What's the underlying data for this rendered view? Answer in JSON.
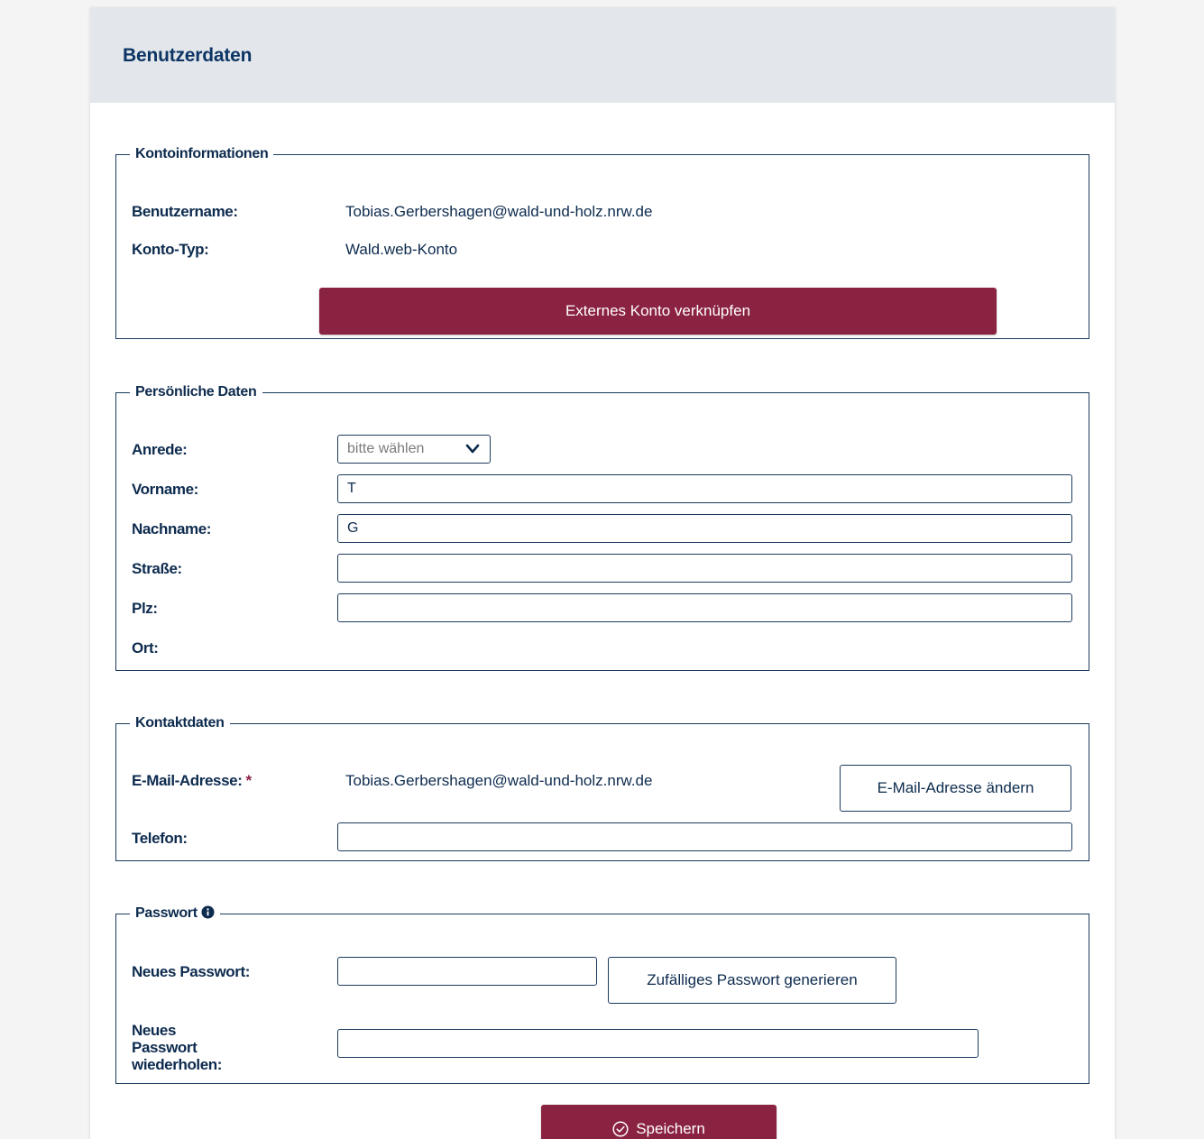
{
  "card": {
    "title": "Benutzerdaten"
  },
  "konto": {
    "legend": "Kontoinformationen",
    "username_label": "Benutzername:",
    "username_value": "Tobias.Gerbershagen@wald-und-holz.nrw.de",
    "type_label": "Konto-Typ:",
    "type_value": "Wald.web-Konto",
    "link_button": "Externes Konto verknüpfen"
  },
  "persoenlich": {
    "legend": "Persönliche Daten",
    "anrede_label": "Anrede:",
    "anrede_selected": "bitte wählen",
    "vorname_label": "Vorname:",
    "vorname_value": "T",
    "nachname_label": "Nachname:",
    "nachname_value": "G",
    "strasse_label": "Straße:",
    "strasse_value": "",
    "plz_label": "Plz:",
    "plz_value": "",
    "ort_label": "Ort:"
  },
  "kontakt": {
    "legend": "Kontaktdaten",
    "email_label": "E-Mail-Adresse:",
    "email_required": "*",
    "email_value": "Tobias.Gerbershagen@wald-und-holz.nrw.de",
    "email_change_button": "E-Mail-Adresse ändern",
    "telefon_label": "Telefon:",
    "telefon_value": ""
  },
  "passwort": {
    "legend": "Passwort",
    "new_label": "Neues Passwort:",
    "new_value": "",
    "generate_button": "Zufälliges Passwort generieren",
    "repeat_label_1": "Neues",
    "repeat_label_2": "Passwort",
    "repeat_label_3": "wiederholen:",
    "repeat_value": ""
  },
  "save_button": "Speichern",
  "colors": {
    "primary": "#8a2242",
    "text": "#0d2b4e",
    "header_bg": "#e3e7eb",
    "annotation_arrow": "#ee0000"
  },
  "icons": {
    "select_chevron": "chevron-down-icon",
    "password_info": "info-circle-icon",
    "save": "check-circle-icon",
    "annotation": "red-arrow-annotation"
  }
}
